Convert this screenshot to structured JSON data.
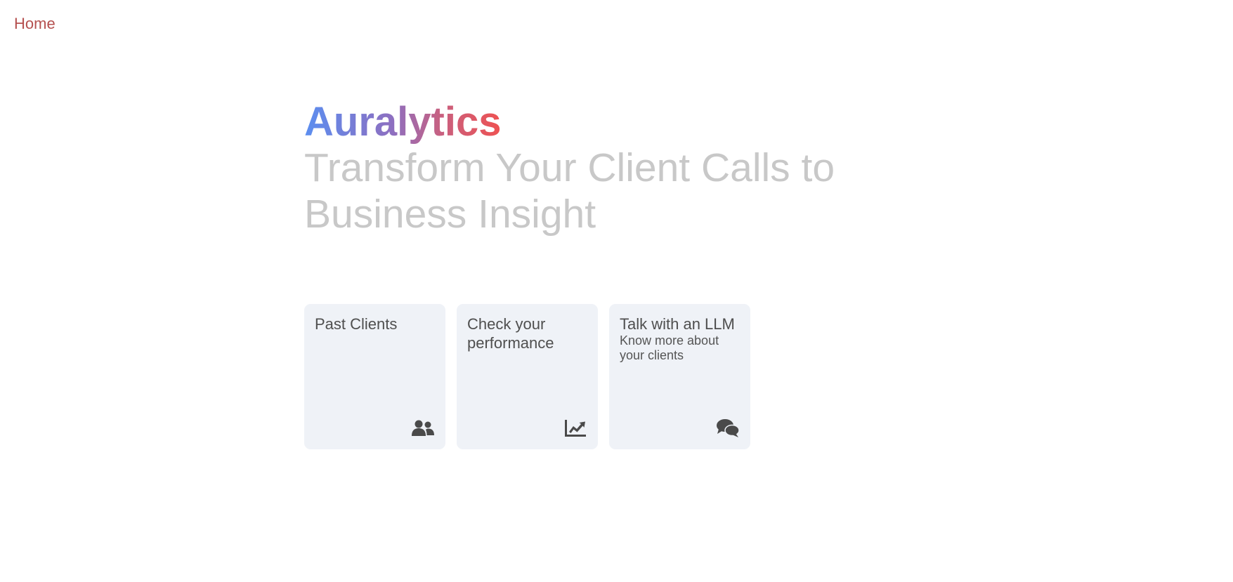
{
  "nav": {
    "home_label": "Home"
  },
  "hero": {
    "brand": "Auralytics",
    "tagline": "Transform Your Client Calls to Business Insight"
  },
  "cards": [
    {
      "title": "Past Clients",
      "description": "",
      "icon": "users-icon"
    },
    {
      "title": "Check your performance",
      "description": "",
      "icon": "chart-line-icon"
    },
    {
      "title": "Talk with an LLM",
      "description": "Know more about your clients",
      "icon": "comments-icon"
    }
  ],
  "colors": {
    "nav_link": "#b5504f",
    "brand_gradient_start": "#5b8ef0",
    "brand_gradient_end": "#ee5252",
    "tagline": "#c8c8c8",
    "card_background": "#eff2f7",
    "card_text": "#4f4f4f",
    "icon": "#4a4a4a"
  }
}
